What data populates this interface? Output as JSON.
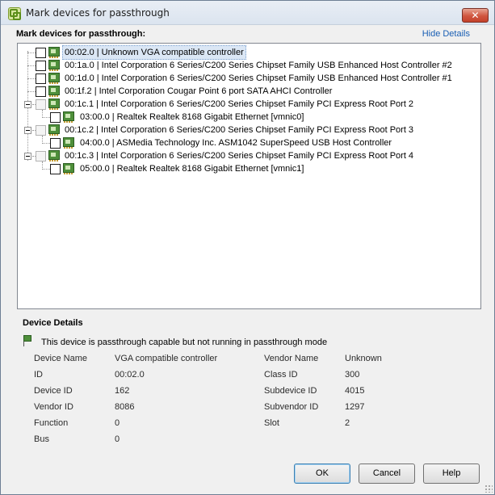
{
  "window": {
    "title": "Mark devices for passthrough",
    "close_label": "✕"
  },
  "list_section": {
    "header": "Mark devices for passthrough:",
    "toggle_link": "Hide Details"
  },
  "devices": [
    {
      "label": "00:02.0 | Unknown VGA compatible controller",
      "checked": false,
      "disabled": false,
      "selected": true
    },
    {
      "label": "00:1a.0 | Intel Corporation 6 Series/C200 Series Chipset Family USB Enhanced Host Controller #2",
      "checked": false,
      "disabled": false
    },
    {
      "label": "00:1d.0 | Intel Corporation 6 Series/C200 Series Chipset Family USB Enhanced Host Controller #1",
      "checked": false,
      "disabled": false
    },
    {
      "label": "00:1f.2 | Intel Corporation Cougar Point 6 port SATA AHCI Controller",
      "checked": false,
      "disabled": false
    },
    {
      "label": "00:1c.1 | Intel Corporation 6 Series/C200 Series Chipset Family PCI Express Root Port 2",
      "checked": false,
      "disabled": true,
      "expanded": true
    },
    {
      "label": "03:00.0 | Realtek Realtek 8168 Gigabit Ethernet [vmnic0]",
      "checked": false,
      "disabled": false,
      "child": true
    },
    {
      "label": "00:1c.2 | Intel Corporation 6 Series/C200 Series Chipset Family PCI Express Root Port 3",
      "checked": false,
      "disabled": true,
      "expanded": true
    },
    {
      "label": "04:00.0 | ASMedia Technology Inc. ASM1042 SuperSpeed USB Host Controller",
      "checked": false,
      "disabled": false,
      "child": true
    },
    {
      "label": "00:1c.3 | Intel Corporation 6 Series/C200 Series Chipset Family PCI Express Root Port 4",
      "checked": false,
      "disabled": true,
      "expanded": true
    },
    {
      "label": "05:00.0 | Realtek Realtek 8168 Gigabit Ethernet [vmnic1]",
      "checked": false,
      "disabled": false,
      "child": true
    }
  ],
  "details": {
    "header": "Device Details",
    "status": "This device is passthrough capable but not running in passthrough mode",
    "left": [
      {
        "label": "Device Name",
        "value": "VGA compatible controller"
      },
      {
        "label": "ID",
        "value": "00:02.0"
      },
      {
        "label": "Device ID",
        "value": "162"
      },
      {
        "label": "Vendor ID",
        "value": "8086"
      },
      {
        "label": "Function",
        "value": "0"
      },
      {
        "label": "Bus",
        "value": "0"
      }
    ],
    "right": [
      {
        "label": "Vendor Name",
        "value": "Unknown"
      },
      {
        "label": "Class ID",
        "value": "300"
      },
      {
        "label": "Subdevice ID",
        "value": "4015"
      },
      {
        "label": "Subvendor ID",
        "value": "1297"
      },
      {
        "label": "Slot",
        "value": "2"
      }
    ]
  },
  "buttons": {
    "ok": "OK",
    "cancel": "Cancel",
    "help": "Help"
  }
}
